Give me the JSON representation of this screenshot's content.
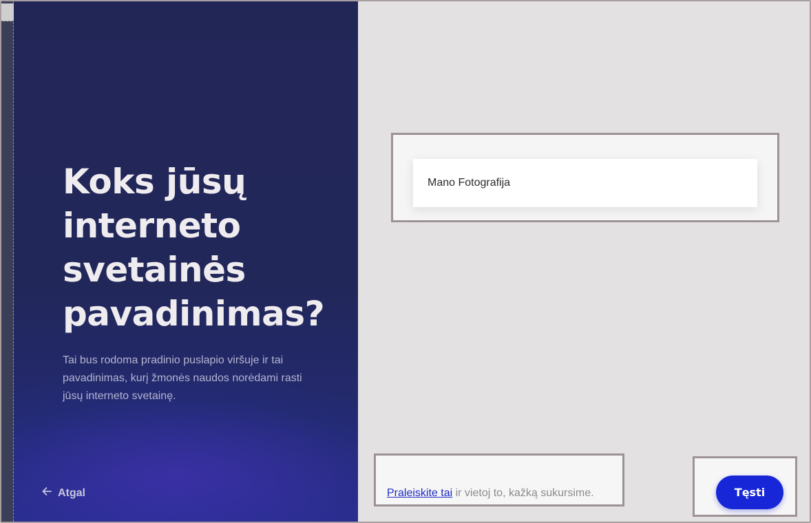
{
  "left_panel": {
    "heading": "Koks jūsų interneto svetainės pavadinimas?",
    "subtitle": "Tai bus rodoma pradinio puslapio viršuje ir tai pavadinimas, kurį žmonės naudos norėdami rasti jūsų interneto svetainę.",
    "back_label": "Atgal",
    "back_icon": "arrow-left-icon"
  },
  "site_name_input": {
    "value": "Mano Fotografija"
  },
  "skip": {
    "link_label": "Praleiskite tai",
    "rest_text": " ir vietoj to, kažką sukursime."
  },
  "continue_button": {
    "label": "Tęsti",
    "color": "#1726d6"
  },
  "colors": {
    "panel": "#222657",
    "background": "#e3e1e2",
    "accent": "#1726d6"
  }
}
